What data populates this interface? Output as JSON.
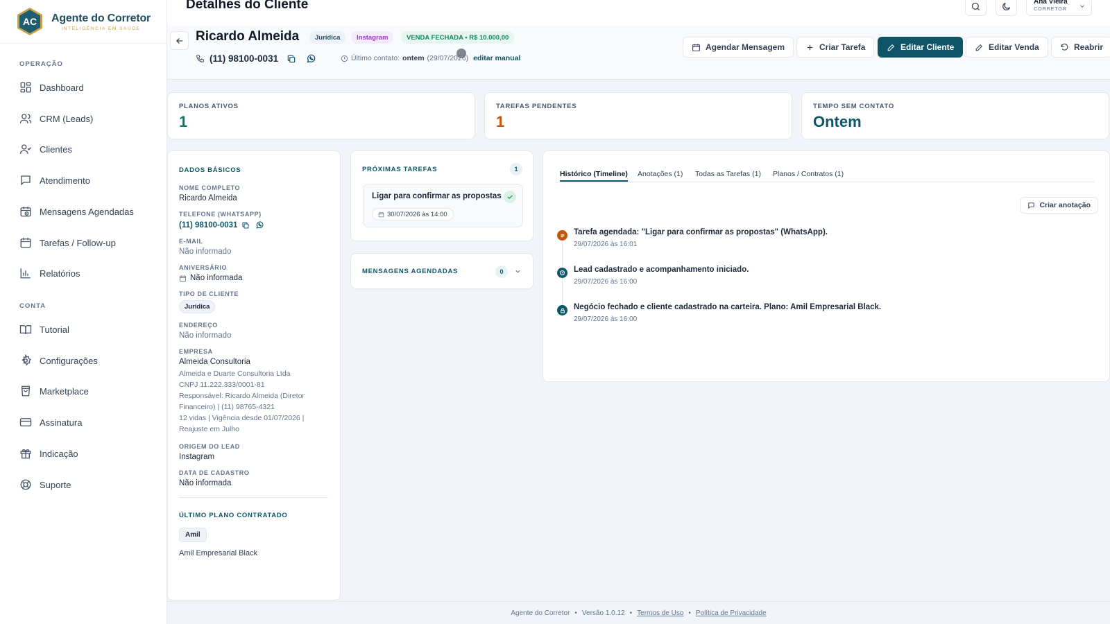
{
  "brand": {
    "logo_text": "AC",
    "name": "Agente do Corretor",
    "tagline": "INTELIGÊNCIA EM SAÚDE"
  },
  "sidebar": {
    "section_ops": "OPERAÇÃO",
    "ops_items": [
      {
        "label": "Dashboard",
        "icon": "dashboard-icon"
      },
      {
        "label": "CRM (Leads)",
        "icon": "users-icon"
      },
      {
        "label": "Clientes",
        "icon": "user-check-icon"
      },
      {
        "label": "Atendimento",
        "icon": "chat-icon"
      },
      {
        "label": "Mensagens Agendadas",
        "icon": "calendar-clock-icon"
      },
      {
        "label": "Tarefas / Follow-up",
        "icon": "calendar-icon"
      },
      {
        "label": "Relatórios",
        "icon": "bar-chart-icon"
      }
    ],
    "section_account": "CONTA",
    "account_items": [
      {
        "label": "Tutorial",
        "icon": "book-icon"
      },
      {
        "label": "Configurações",
        "icon": "gear-icon"
      },
      {
        "label": "Marketplace",
        "icon": "shopping-bag-icon"
      },
      {
        "label": "Assinatura",
        "icon": "credit-card-icon"
      },
      {
        "label": "Indicação",
        "icon": "gift-icon"
      },
      {
        "label": "Suporte",
        "icon": "lifebuoy-icon"
      }
    ]
  },
  "header": {
    "title": "Detalhes do Cliente",
    "user_name": "Ana Vieira",
    "user_role": "CORRETOR"
  },
  "client": {
    "name": "Ricardo Almeida",
    "badge_type": "Jurídica",
    "badge_source": "Instagram",
    "badge_status": "VENDA FECHADA • R$ 10.000,00",
    "phone": "(11) 98100-0031",
    "last_contact_label": "Último contato:",
    "last_contact_value": "ontem",
    "last_contact_date": "(29/07/2026)",
    "edit_manual": "editar manual"
  },
  "actions": {
    "schedule": "Agendar Mensagem",
    "task": "Criar Tarefa",
    "edit_client": "Editar Cliente",
    "edit_sale": "Editar Venda",
    "reopen": "Reabrir"
  },
  "stats": [
    {
      "label": "PLANOS ATIVOS",
      "value": "1",
      "color": "#0e7a5f"
    },
    {
      "label": "TAREFAS PENDENTES",
      "value": "1",
      "color": "#c2560c"
    },
    {
      "label": "TEMPO SEM CONTATO",
      "value": "Ontem",
      "color": "#0e5669"
    }
  ],
  "basic": {
    "title": "DADOS BÁSICOS",
    "full_name_label": "NOME COMPLETO",
    "full_name": "Ricardo Almeida",
    "phone_label": "TELEFONE (WHATSAPP)",
    "phone": "(11) 98100-0031",
    "email_label": "E-MAIL",
    "email": "Não informado",
    "birthday_label": "ANIVERSÁRIO",
    "birthday": "Não informada",
    "type_label": "TIPO DE CLIENTE",
    "type": "Jurídica",
    "address_label": "ENDEREÇO",
    "address": "Não informado",
    "company_label": "EMPRESA",
    "company": "Almeida Consultoria",
    "company_legal": "Almeida e Duarte Consultoria Ltda",
    "company_cnpj": "CNPJ 11.222.333/0001-81",
    "company_resp": "Responsável: Ricardo Almeida (Diretor Financeiro) | (11) 98765-4321",
    "company_lives": "12 vidas | Vigência desde 01/07/2026 | Reajuste em Julho",
    "origin_label": "ORIGEM DO LEAD",
    "origin": "Instagram",
    "created_label": "DATA DE CADASTRO",
    "created": "Não informada",
    "last_plan_title": "ÚLTIMO PLANO CONTRATADO",
    "plan_operator": "Amil",
    "plan_name": "Amil Empresarial Black"
  },
  "next_tasks": {
    "title": "PRÓXIMAS TAREFAS",
    "count": "1",
    "task_title": "Ligar para confirmar as propostas",
    "task_date": "30/07/2026 às 14:00"
  },
  "scheduled": {
    "title": "MENSAGENS AGENDADAS",
    "count": "0"
  },
  "timeline": {
    "tabs": [
      "Histórico (Timeline)",
      "Anotações (1)",
      "Todas as Tarefas (1)",
      "Planos / Contratos (1)"
    ],
    "create_note": "Criar anotação",
    "events": [
      {
        "title": "Tarefa agendada: \"Ligar para confirmar as propostas\" (WhatsApp).",
        "date": "29/07/2026 às 16:01",
        "color": "#c2560c",
        "icon": "task-icon"
      },
      {
        "title": "Lead cadastrado e acompanhamento iniciado.",
        "date": "29/07/2026 às 16:00",
        "color": "#0e5669",
        "icon": "clock-icon"
      },
      {
        "title": "Negócio fechado e cliente cadastrado na carteira. Plano: Amil Empresarial Black.",
        "date": "29/07/2026 às 16:00",
        "color": "#0e5669",
        "icon": "lock-icon"
      }
    ]
  },
  "footer": {
    "brand": "Agente do Corretor",
    "version": "Versão 1.0.12",
    "terms": "Termos de Uso",
    "privacy": "Política de Privacidade"
  }
}
